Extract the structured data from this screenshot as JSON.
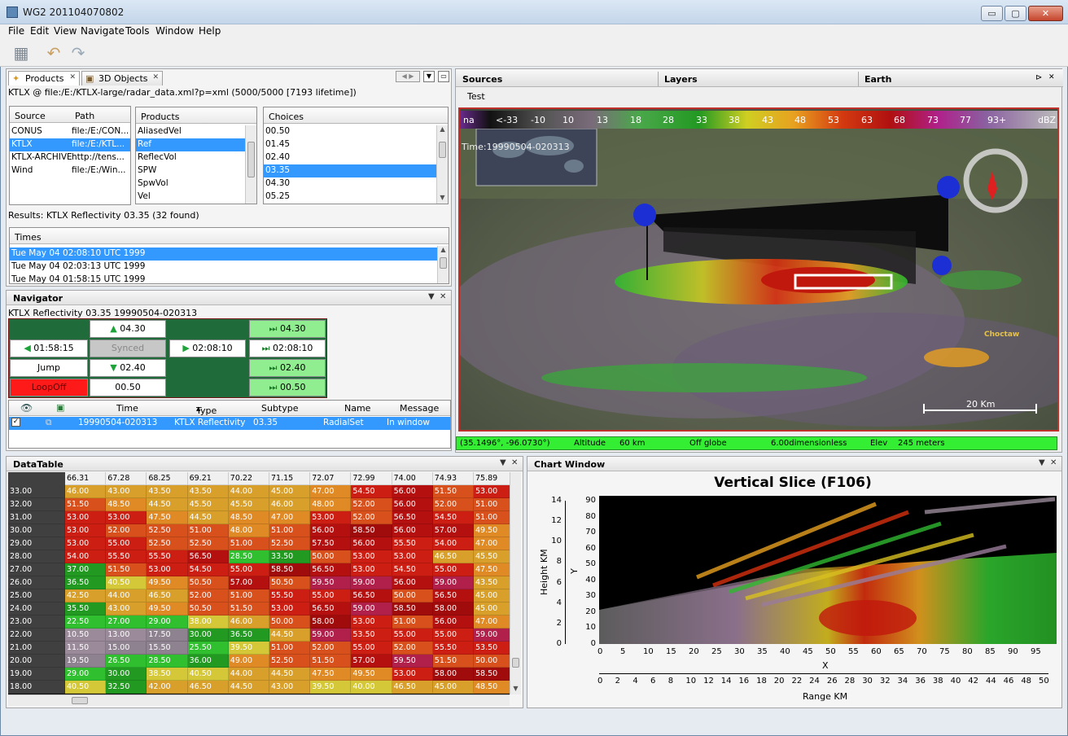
{
  "window": {
    "title": "WG2 201104070802",
    "min": "▭",
    "max": "▢",
    "close": "✕"
  },
  "menu": [
    "File",
    "Edit",
    "View",
    "Navigate",
    "Tools",
    "Window",
    "Help"
  ],
  "toolbar": {
    "save_icon": "save-icon",
    "undo_icon": "undo-icon",
    "redo_icon": "redo-icon"
  },
  "products_panel": {
    "tabs": [
      {
        "label": "Products"
      },
      {
        "label": "3D Objects"
      }
    ],
    "source_line": "KTLX @ file:/E:/KTLX-large/radar_data.xml?p=xml (5000/5000 [7193 lifetime])",
    "sources": {
      "headers": [
        "Source",
        "Path"
      ],
      "rows": [
        [
          "CONUS",
          "file:/E:/CON..."
        ],
        [
          "KTLX",
          "file:/E:/KTL..."
        ],
        [
          "KTLX-ARCHIVE",
          "http://tens..."
        ],
        [
          "Wind",
          "file:/E:/Win..."
        ]
      ]
    },
    "products": {
      "header": "Products",
      "items": [
        "AliasedVel",
        "Ref",
        "ReflecVol",
        "SPW",
        "SpwVol",
        "Vel"
      ]
    },
    "choices": {
      "header": "Choices",
      "items": [
        "00.50",
        "01.45",
        "02.40",
        "03.35",
        "04.30",
        "05.25"
      ]
    },
    "results": "Results: KTLX Reflectivity 03.35 (32 found)",
    "times": {
      "header": "Times",
      "items": [
        "Tue May 04 02:08:10 UTC 1999",
        "Tue May 04 02:03:13 UTC 1999",
        "Tue May 04 01:58:15 UTC 1999"
      ]
    }
  },
  "navigator": {
    "title": "Navigator",
    "subtitle": "KTLX Reflectivity 03.35 19990504-020313",
    "up": "04.30",
    "prev_time": "01:58:15",
    "synced": "Synced",
    "next_time": "02:08:10",
    "jump": "Jump",
    "down": "02.40",
    "loop": "LoopOff",
    "current": "00.50",
    "right_col": [
      "04.30",
      "02:08:10",
      "02.40",
      "00.50"
    ],
    "table": {
      "headers": [
        "Time",
        "Type",
        "Subtype",
        "Name",
        "Message"
      ],
      "row": {
        "time": "19990504-020313",
        "type": "KTLX Reflectivity",
        "subtype": "03.35",
        "name": "RadialSet",
        "message": "In window"
      }
    }
  },
  "earth_panel": {
    "tabs": [
      "Sources",
      "Layers",
      "Earth"
    ],
    "test_label": "Test",
    "legend": [
      "na",
      "<-33",
      "-10",
      "10",
      "13",
      "18",
      "28",
      "33",
      "38",
      "43",
      "48",
      "53",
      "63",
      "68",
      "73",
      "77",
      "93+",
      "dBZ"
    ],
    "time": "Time:19990504-020313",
    "place": "Choctaw",
    "scale": "20 Km",
    "status": {
      "coords": "(35.1496°, -96.0730°)",
      "altitude": "Altitude",
      "alt_val": "60 km",
      "globe": "Off globe",
      "dim": "6.00dimensionless",
      "elev": "Elev",
      "elev_val": "245 meters"
    }
  },
  "datatable": {
    "title": "DataTable",
    "columns": [
      "66.31",
      "67.28",
      "68.25",
      "69.21",
      "70.22",
      "71.15",
      "72.07",
      "72.99",
      "74.00",
      "74.93",
      "75.89"
    ],
    "rows": [
      {
        "h": "33.00",
        "v": [
          "46.00",
          "43.00",
          "43.50",
          "43.50",
          "44.00",
          "45.00",
          "47.00",
          "54.50",
          "56.00",
          "51.50",
          "53.00"
        ]
      },
      {
        "h": "32.00",
        "v": [
          "51.50",
          "48.50",
          "44.50",
          "45.50",
          "45.50",
          "46.00",
          "48.00",
          "52.00",
          "56.00",
          "52.00",
          "51.00"
        ]
      },
      {
        "h": "31.00",
        "v": [
          "53.00",
          "53.00",
          "47.50",
          "44.50",
          "48.50",
          "47.00",
          "53.00",
          "52.00",
          "56.50",
          "54.50",
          "51.00"
        ]
      },
      {
        "h": "30.00",
        "v": [
          "53.00",
          "52.00",
          "52.50",
          "51.00",
          "48.00",
          "51.00",
          "56.00",
          "58.50",
          "56.00",
          "57.00",
          "49.50"
        ]
      },
      {
        "h": "29.00",
        "v": [
          "53.00",
          "55.00",
          "52.50",
          "52.50",
          "51.00",
          "52.50",
          "57.50",
          "56.00",
          "55.50",
          "54.00",
          "47.00"
        ]
      },
      {
        "h": "28.00",
        "v": [
          "54.00",
          "55.50",
          "55.50",
          "56.50",
          "28.50",
          "33.50",
          "50.00",
          "53.00",
          "53.00",
          "46.50",
          "45.50"
        ]
      },
      {
        "h": "27.00",
        "v": [
          "37.00",
          "51.50",
          "53.00",
          "54.50",
          "55.00",
          "58.50",
          "56.50",
          "53.00",
          "54.50",
          "55.00",
          "47.50"
        ]
      },
      {
        "h": "26.00",
        "v": [
          "36.50",
          "40.50",
          "49.50",
          "50.50",
          "57.00",
          "50.50",
          "59.50",
          "59.00",
          "56.00",
          "59.00",
          "43.50"
        ]
      },
      {
        "h": "25.00",
        "v": [
          "42.50",
          "44.00",
          "46.50",
          "52.00",
          "51.00",
          "55.50",
          "55.00",
          "56.50",
          "50.00",
          "56.50",
          "45.00"
        ]
      },
      {
        "h": "24.00",
        "v": [
          "35.50",
          "43.00",
          "49.50",
          "50.50",
          "51.50",
          "53.00",
          "56.50",
          "59.00",
          "58.50",
          "58.00",
          "45.00"
        ]
      },
      {
        "h": "23.00",
        "v": [
          "22.50",
          "27.00",
          "29.00",
          "38.00",
          "46.00",
          "50.00",
          "58.00",
          "53.00",
          "51.00",
          "56.00",
          "47.00"
        ]
      },
      {
        "h": "22.00",
        "v": [
          "10.50",
          "13.00",
          "17.50",
          "30.00",
          "36.50",
          "44.50",
          "59.00",
          "53.50",
          "55.00",
          "55.00",
          "59.00"
        ]
      },
      {
        "h": "21.00",
        "v": [
          "11.50",
          "15.00",
          "15.50",
          "25.50",
          "39.50",
          "51.00",
          "52.00",
          "55.00",
          "52.00",
          "55.50",
          "53.50"
        ]
      },
      {
        "h": "20.00",
        "v": [
          "19.50",
          "26.50",
          "28.50",
          "36.00",
          "49.00",
          "52.50",
          "51.50",
          "57.00",
          "59.50",
          "51.50",
          "50.00"
        ]
      },
      {
        "h": "19.00",
        "v": [
          "29.00",
          "30.00",
          "38.50",
          "40.50",
          "44.00",
          "44.50",
          "47.50",
          "49.50",
          "53.00",
          "58.00",
          "58.50"
        ]
      },
      {
        "h": "18.00",
        "v": [
          "40.50",
          "32.50",
          "42.00",
          "46.50",
          "44.50",
          "43.00",
          "39.50",
          "40.00",
          "46.50",
          "45.00",
          "48.50"
        ]
      }
    ]
  },
  "chart_window": {
    "title": "Chart Window",
    "chart_title": "Vertical Slice (F106)",
    "ylabel_outer": "Height KM",
    "ylabel_inner": "Y",
    "xlabel_inner": "X",
    "xlabel_outer": "Range KM",
    "height_ticks": [
      "14",
      "12",
      "10",
      "8",
      "6",
      "4",
      "2",
      "0"
    ],
    "y_ticks": [
      "90",
      "80",
      "70",
      "60",
      "50",
      "40",
      "30",
      "20",
      "10",
      "0"
    ],
    "x_ticks": [
      "0",
      "5",
      "10",
      "15",
      "20",
      "25",
      "30",
      "35",
      "40",
      "45",
      "50",
      "55",
      "60",
      "65",
      "70",
      "75",
      "80",
      "85",
      "90",
      "95"
    ],
    "range_ticks": [
      "0",
      "2",
      "4",
      "6",
      "8",
      "10",
      "12",
      "14",
      "16",
      "18",
      "20",
      "22",
      "24",
      "26",
      "28",
      "30",
      "32",
      "34",
      "36",
      "38",
      "40",
      "42",
      "44",
      "46",
      "48",
      "50"
    ]
  },
  "colors": {
    "selection": "#3399ff",
    "nav_green": "#1f6b3a",
    "light_green": "#90ee90",
    "loop_red": "#ff1a1a",
    "status_green": "#33ee33"
  }
}
